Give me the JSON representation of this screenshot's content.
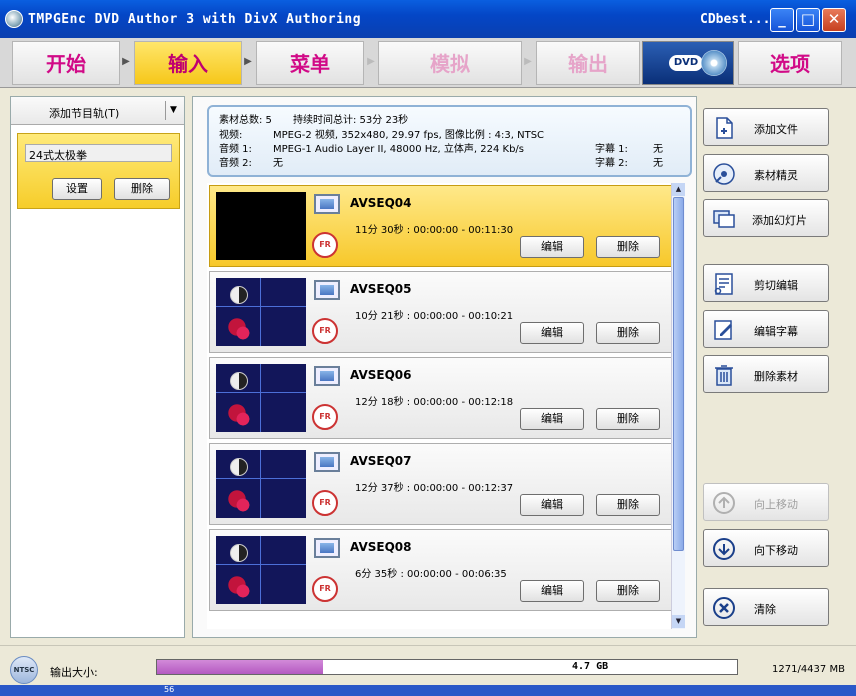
{
  "window": {
    "title": "TMPGEnc DVD Author 3 with DivX Authoring",
    "right_title": "CDbest...",
    "min": "_",
    "max": "□",
    "close": "✕"
  },
  "nav": {
    "tabs": [
      {
        "label": "开始",
        "state": "normal"
      },
      {
        "label": "输入",
        "state": "active"
      },
      {
        "label": "菜单",
        "state": "normal"
      },
      {
        "label": "模拟",
        "state": "disabled"
      },
      {
        "label": "输出",
        "state": "disabled"
      },
      {
        "label": "选项",
        "state": "normal"
      }
    ],
    "dvd_badge": "DVD"
  },
  "left": {
    "combo_label": "添加节目轨(T)",
    "combo_arrow": "▼",
    "track_name": "24式太极拳",
    "settings_btn": "设置",
    "delete_btn": "删除"
  },
  "info": {
    "count_label": "素材总数: 5",
    "duration_label": "持续时间总计: 53分 23秒",
    "video_label": "视频:",
    "video_value": "MPEG-2 视频, 352x480, 29.97 fps, 图像比例 : 4:3, NTSC",
    "audio1_label": "音频 1:",
    "audio1_value": "MPEG-1 Audio Layer II, 48000 Hz, 立体声, 224 Kb/s",
    "audio2_label": "音频 2:",
    "audio2_value": "无",
    "sub1_label": "字幕 1:",
    "sub1_value": "无",
    "sub2_label": "字幕 2:",
    "sub2_value": "无"
  },
  "clips": [
    {
      "name": "AVSEQ04",
      "duration": "11分 30秒 :  00:00:00 - 00:11:30",
      "edit": "编辑",
      "delete": "删除",
      "selected": true
    },
    {
      "name": "AVSEQ05",
      "duration": "10分 21秒 :  00:00:00 - 00:10:21",
      "edit": "编辑",
      "delete": "删除",
      "selected": false
    },
    {
      "name": "AVSEQ06",
      "duration": "12分 18秒 :  00:00:00 - 00:12:18",
      "edit": "编辑",
      "delete": "删除",
      "selected": false
    },
    {
      "name": "AVSEQ07",
      "duration": "12分 37秒 :  00:00:00 - 00:12:37",
      "edit": "编辑",
      "delete": "删除",
      "selected": false
    },
    {
      "name": "AVSEQ08",
      "duration": "6分 35秒 :  00:00:00 - 00:06:35",
      "edit": "编辑",
      "delete": "删除",
      "selected": false
    }
  ],
  "badges": {
    "fr": "FR"
  },
  "scroll": {
    "up": "▲",
    "down": "▼"
  },
  "actions": [
    {
      "label": "添加文件",
      "icon": "add-file-icon",
      "enabled": true
    },
    {
      "label": "素材精灵",
      "icon": "wizard-disc-icon",
      "enabled": true
    },
    {
      "label": "添加幻灯片",
      "icon": "slideshow-icon",
      "enabled": true
    },
    {
      "label": "剪切编辑",
      "icon": "cut-edit-icon",
      "enabled": true
    },
    {
      "label": "编辑字幕",
      "icon": "edit-subtitle-icon",
      "enabled": true
    },
    {
      "label": "删除素材",
      "icon": "trash-icon",
      "enabled": true
    },
    {
      "label": "向上移动",
      "icon": "arrow-up-icon",
      "enabled": false
    },
    {
      "label": "向下移动",
      "icon": "arrow-down-icon",
      "enabled": true
    },
    {
      "label": "清除",
      "icon": "clear-icon",
      "enabled": true
    }
  ],
  "bottom": {
    "ntsc": "NTSC",
    "size_label": "输出大小:",
    "progress_fraction": 0.2864,
    "capacity": "4.7 GB",
    "usage": "1271/4437 MB",
    "strip_text": "56"
  },
  "colors": {
    "titlebar": "#0446c6",
    "active_tab": "#f6c71a",
    "accent_pink": "#d10a87",
    "progress_fill": "#b459c1"
  }
}
